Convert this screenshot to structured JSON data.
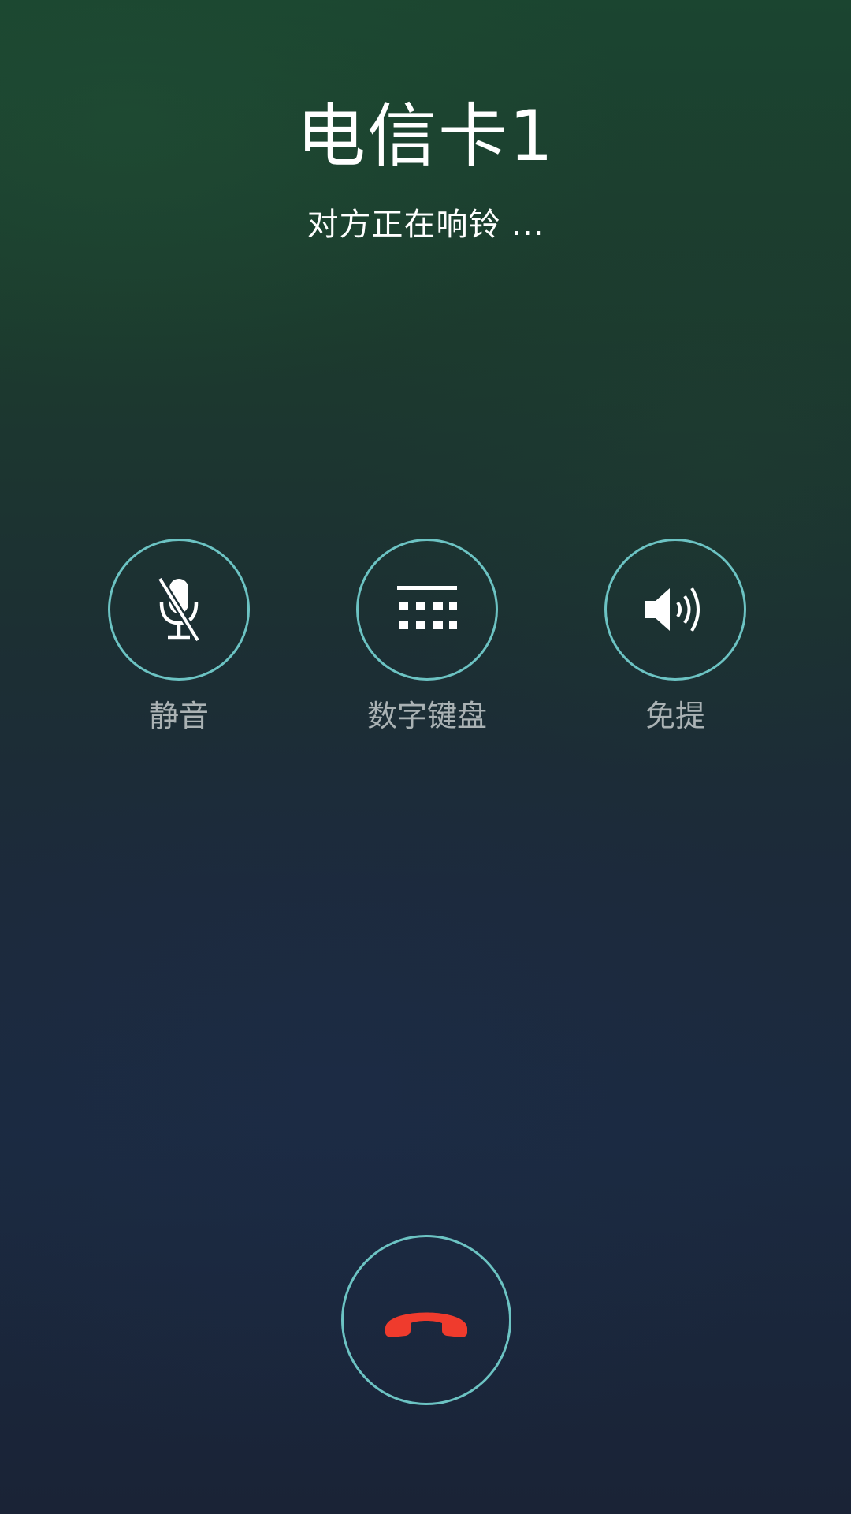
{
  "call": {
    "caller_name": "电信卡1",
    "status": "对方正在响铃 ..."
  },
  "controls": {
    "mute": {
      "label": "静音",
      "icon": "mic-off-icon"
    },
    "keypad": {
      "label": "数字键盘",
      "icon": "dialpad-icon"
    },
    "speaker": {
      "label": "免提",
      "icon": "speaker-icon"
    }
  },
  "hangup": {
    "icon": "hang-up-icon"
  },
  "colors": {
    "ring_accent": "#6cc3c3",
    "hangup_red": "#ef3b2d",
    "label_gray": "#aab2b4",
    "background_top": "#1b4530",
    "background_bottom": "#1a2336"
  }
}
